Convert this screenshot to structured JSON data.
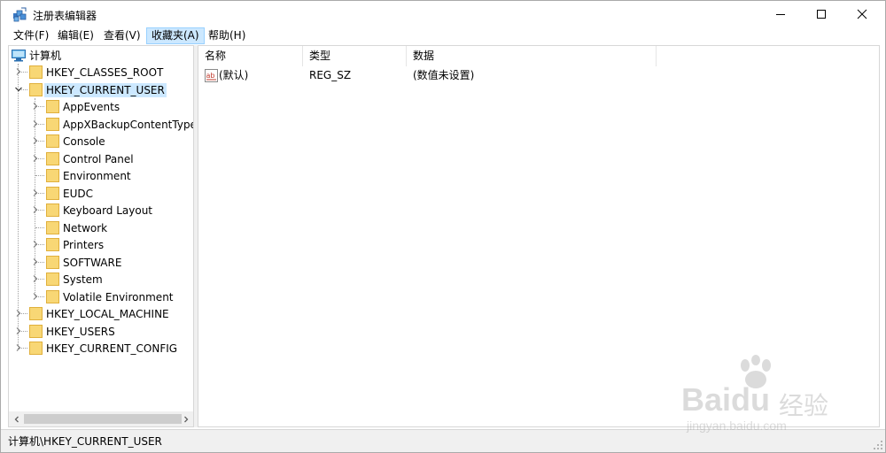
{
  "window": {
    "title": "注册表编辑器"
  },
  "menu": {
    "items": [
      {
        "label": "文件(F)"
      },
      {
        "label": "编辑(E)"
      },
      {
        "label": "查看(V)"
      },
      {
        "label": "收藏夹(A)"
      },
      {
        "label": "帮助(H)"
      }
    ],
    "active_index": 3
  },
  "tree": {
    "root": "计算机",
    "nodes": [
      {
        "label": "HKEY_CLASSES_ROOT",
        "level": 1,
        "expandable": true
      },
      {
        "label": "HKEY_CURRENT_USER",
        "level": 1,
        "expanded": true,
        "selected": true
      },
      {
        "label": "AppEvents",
        "level": 2,
        "expandable": true
      },
      {
        "label": "AppXBackupContentType",
        "level": 2,
        "expandable": true
      },
      {
        "label": "Console",
        "level": 2,
        "expandable": true
      },
      {
        "label": "Control Panel",
        "level": 2,
        "expandable": true
      },
      {
        "label": "Environment",
        "level": 2,
        "expandable": false
      },
      {
        "label": "EUDC",
        "level": 2,
        "expandable": true
      },
      {
        "label": "Keyboard Layout",
        "level": 2,
        "expandable": true
      },
      {
        "label": "Network",
        "level": 2,
        "expandable": false
      },
      {
        "label": "Printers",
        "level": 2,
        "expandable": true
      },
      {
        "label": "SOFTWARE",
        "level": 2,
        "expandable": true
      },
      {
        "label": "System",
        "level": 2,
        "expandable": true
      },
      {
        "label": "Volatile Environment",
        "level": 2,
        "expandable": true
      },
      {
        "label": "HKEY_LOCAL_MACHINE",
        "level": 1,
        "expandable": true
      },
      {
        "label": "HKEY_USERS",
        "level": 1,
        "expandable": true
      },
      {
        "label": "HKEY_CURRENT_CONFIG",
        "level": 1,
        "expandable": true
      }
    ]
  },
  "list": {
    "columns": [
      {
        "label": "名称"
      },
      {
        "label": "类型"
      },
      {
        "label": "数据"
      }
    ],
    "rows": [
      {
        "name": "(默认)",
        "type": "REG_SZ",
        "data": "(数值未设置)",
        "icon": "string-value-icon"
      }
    ]
  },
  "status": {
    "path": "计算机\\HKEY_CURRENT_USER"
  },
  "watermark": {
    "brand": "Baidu",
    "suffix": "经验",
    "url": "jingyan.baidu.com"
  },
  "colors": {
    "selection": "#cce8ff",
    "folder": "#f8d775",
    "folder_edge": "#e0b03c"
  }
}
